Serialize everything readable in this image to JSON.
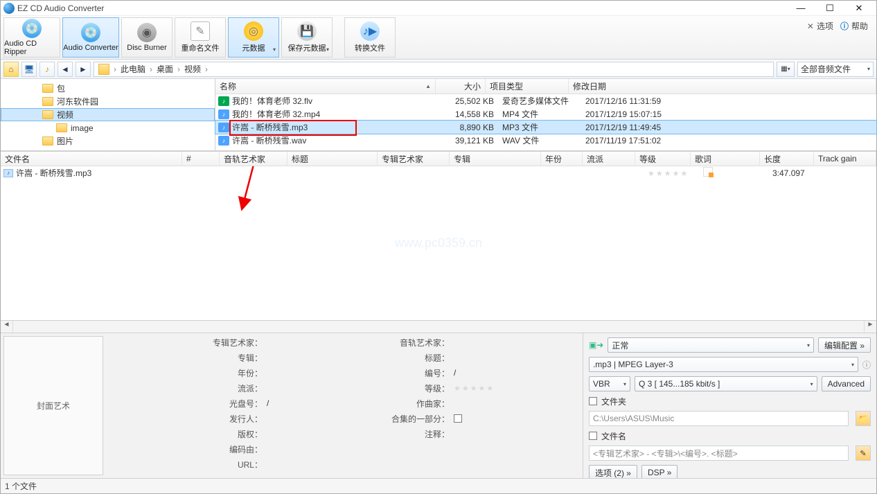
{
  "window": {
    "title": "EZ CD Audio Converter"
  },
  "watermark": "www.pc0359.cn",
  "toolbar": {
    "ripper": "Audio CD Ripper",
    "converter": "Audio Converter",
    "disc": "Disc Burner",
    "rename": "重命名文件",
    "metadata": "元数据",
    "savemeta": "保存元数据",
    "convert": "转换文件",
    "options": "选项",
    "help": "帮助"
  },
  "breadcrumb": {
    "pc": "此电脑",
    "desktop": "桌面",
    "video": "视频"
  },
  "filter": "全部音频文件",
  "tree": {
    "bao": "包",
    "hedong": "河东软件园",
    "video": "视频",
    "image": "image",
    "pic": "图片"
  },
  "flheaders": {
    "name": "名称",
    "size": "大小",
    "type": "项目类型",
    "date": "修改日期"
  },
  "files": [
    {
      "name": "我的！体育老师 32.flv",
      "size": "25,502 KB",
      "type": "爱奇艺多媒体文件",
      "date": "2017/12/16 11:31:59",
      "icon": "#00a651"
    },
    {
      "name": "我的！体育老师 32.mp4",
      "size": "14,558 KB",
      "type": "MP4 文件",
      "date": "2017/12/19 15:07:15",
      "icon": "#4da3ff"
    },
    {
      "name": "许嵩 - 断桥残雪.mp3",
      "size": "8,890 KB",
      "type": "MP3 文件",
      "date": "2017/12/19 11:49:45",
      "icon": "#4da3ff",
      "sel": true,
      "red": true
    },
    {
      "name": "许嵩 - 断桥残雪.wav",
      "size": "39,121 KB",
      "type": "WAV 文件",
      "date": "2017/11/19 17:51:02",
      "icon": "#4da3ff"
    }
  ],
  "qheaders": {
    "filename": "文件名",
    "num": "#",
    "trackartist": "音轨艺术家",
    "title": "标题",
    "albumartist": "专辑艺术家",
    "album": "专辑",
    "year": "年份",
    "genre": "流派",
    "rating": "等级",
    "lyrics": "歌词",
    "length": "长度",
    "trackgain": "Track gain"
  },
  "queue": [
    {
      "name": "许嵩 - 断桥残雪.mp3",
      "length": "3:47.097"
    }
  ],
  "meta": {
    "albumart": "封面艺术",
    "albumartist": "专辑艺术家：",
    "album": "专辑：",
    "year": "年份：",
    "genre": "流派：",
    "discnum": "光盘号：",
    "discval": "/",
    "publisher": "发行人：",
    "copyright": "版权：",
    "encodedby": "编码由：",
    "url": "URL：",
    "trackartist": "音轨艺术家：",
    "title": "标题：",
    "tracknum": "编号：",
    "trackval": "/",
    "rating": "等级：",
    "composer": "作曲家：",
    "partof": "合集的一部分：",
    "comment": "注释："
  },
  "encoder": {
    "profile": "正常",
    "editconfig": "编辑配置 »",
    "format": ".mp3 | MPEG Layer-3",
    "mode": "VBR",
    "quality": "Q 3   [ 145...185 kbit/s ]",
    "advanced": "Advanced",
    "folder_lbl": "文件夹",
    "folder_val": "C:\\Users\\ASUS\\Music",
    "filename_lbl": "文件名",
    "filename_val": "<专辑艺术家> - <专辑>\\<编号>. <标题>",
    "options": "选项 (2) »",
    "dsp": "DSP »"
  },
  "status": "1 个文件"
}
